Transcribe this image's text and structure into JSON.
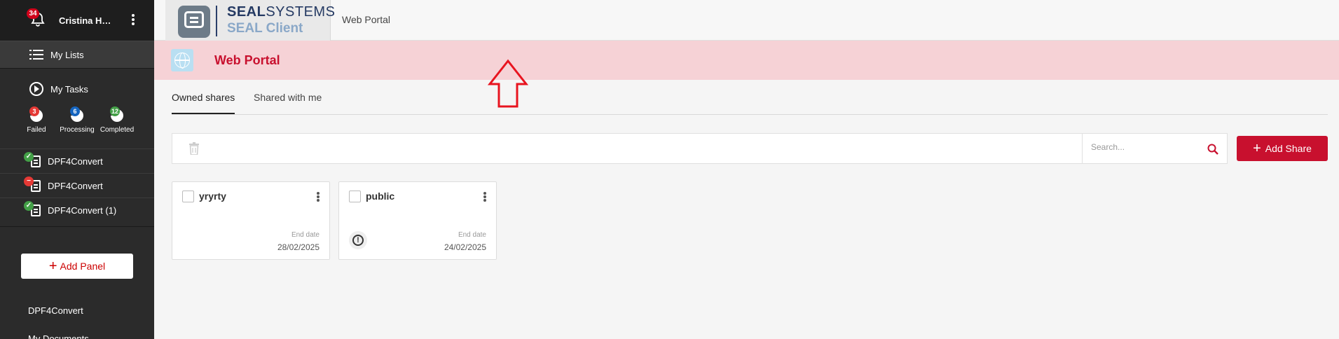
{
  "sidebar": {
    "notification_count": "34",
    "user_name": "Cristina Hog...",
    "my_lists": "My Lists",
    "my_tasks": "My Tasks",
    "task_stats": [
      {
        "count": "3",
        "label": "Failed",
        "color": "#e53935"
      },
      {
        "count": "6",
        "label": "Processing",
        "color": "#1565c0"
      },
      {
        "count": "12",
        "label": "Completed",
        "color": "#43a047"
      }
    ],
    "jobs": [
      {
        "label": "DPF4Convert",
        "status": "success"
      },
      {
        "label": "DPF4Convert",
        "status": "failed"
      },
      {
        "label": "DPF4Convert (1)",
        "status": "success"
      }
    ],
    "add_panel": "Add Panel",
    "panels": [
      "DPF4Convert",
      "My Documents"
    ]
  },
  "topbar": {
    "logo_line1_bold": "SEAL",
    "logo_line1_rest": "SYSTEMS",
    "logo_line2": "SEAL Client",
    "breadcrumb": "Web Portal"
  },
  "page": {
    "title": "Web Portal",
    "accent": "#c8102e",
    "header_bg": "#f6d2d6"
  },
  "tabs": [
    {
      "label": "Owned shares",
      "active": true
    },
    {
      "label": "Shared with me",
      "active": false
    }
  ],
  "toolbar": {
    "search_placeholder": "Search...",
    "add_share": "Add Share"
  },
  "cards": [
    {
      "name": "yryrty",
      "end_label": "End date",
      "end_date": "28/02/2025",
      "warning": false
    },
    {
      "name": "public",
      "end_label": "End date",
      "end_date": "24/02/2025",
      "warning": true
    }
  ]
}
